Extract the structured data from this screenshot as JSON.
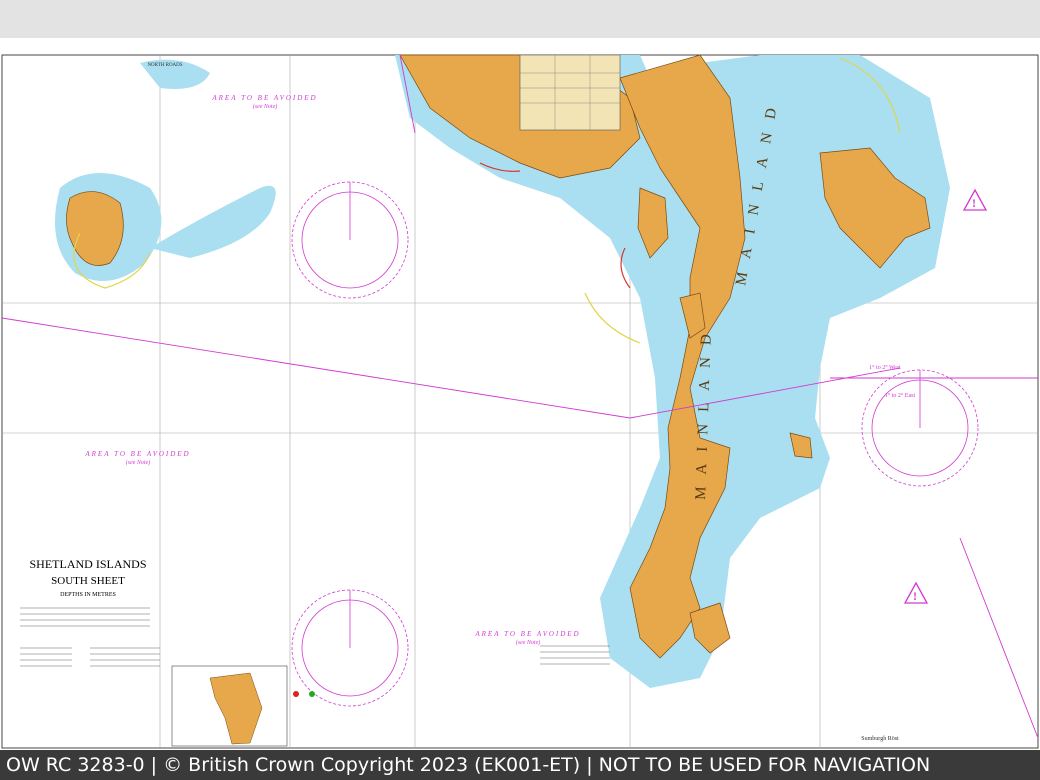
{
  "map": {
    "title": "SHETLAND ISLANDS",
    "subtitle": "SOUTH SHEET",
    "depths_note": "DEPTHS IN METRES",
    "mainland_label": "MAINLAND",
    "avoid_label_1": "AREA TO BE AVOIDED",
    "avoid_label_2": "AREA TO BE AVOIDED",
    "avoid_label_3": "AREA TO BE AVOIDED",
    "avoid_sub": "(see Note)",
    "variation_1": "1° to 2° West",
    "variation_2": "1° to 2° East",
    "north_label": "NORTH ROADS",
    "sumburgh_label": "Sumburgh Röst",
    "colors": {
      "land": "#e6a84a",
      "shallow": "#a9dff0",
      "deep": "#ffffff",
      "magenta": "#d23ad2",
      "grid": "#9a9a9a"
    }
  },
  "footer": {
    "text": "OW RC 3283-0 | © British Crown Copyright 2023 (EK001-ET) | NOT TO BE USED FOR NAVIGATION"
  }
}
